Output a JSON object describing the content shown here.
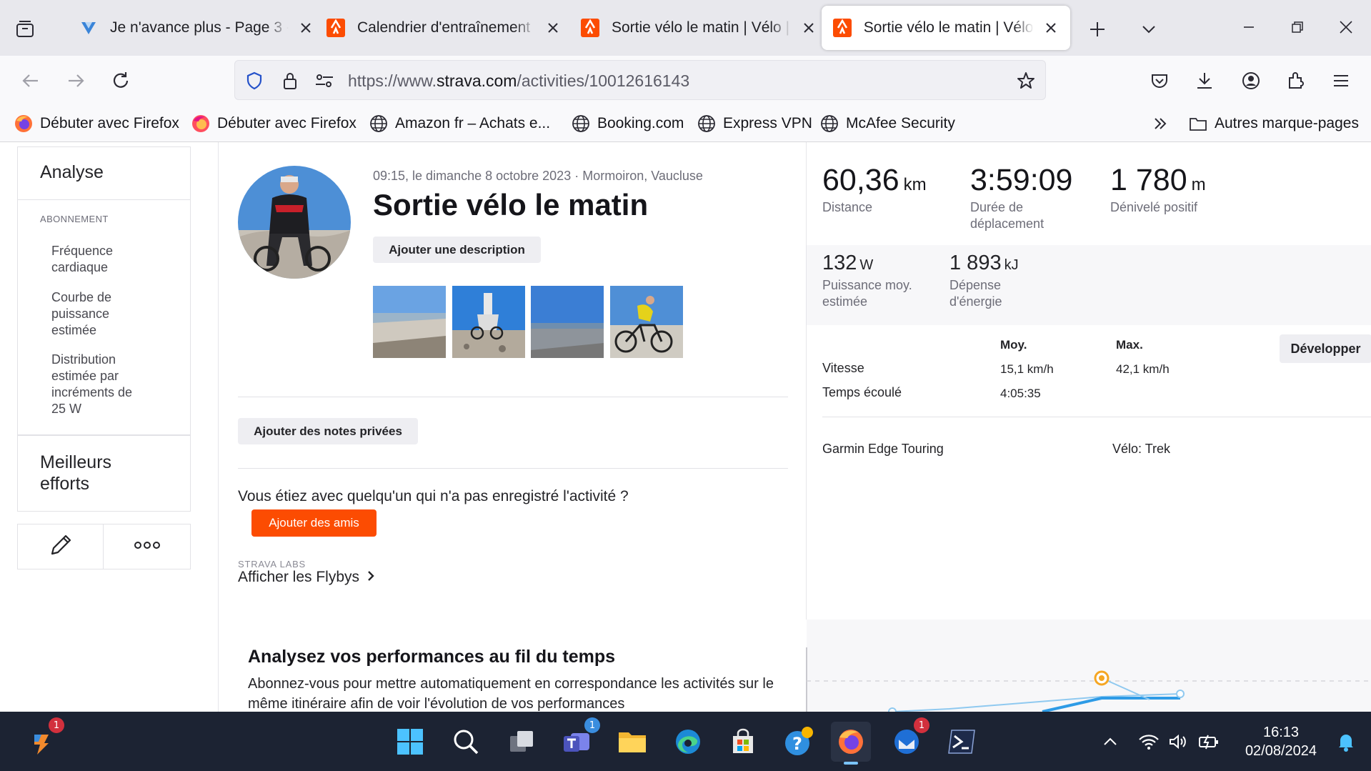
{
  "browser": {
    "tabs": [
      {
        "title": "Je n'avance plus - Page 3 - ",
        "favicon": "mail-v-icon",
        "active": false
      },
      {
        "title": "Calendrier d'entraînement | ",
        "favicon": "strava-icon",
        "active": false
      },
      {
        "title": "Sortie vélo le matin | Vélo | ",
        "favicon": "strava-icon",
        "active": false
      },
      {
        "title": "Sortie vélo le matin | Vélo | ",
        "favicon": "strava-icon",
        "active": true
      }
    ],
    "url": {
      "prefix": "https://www.",
      "host": "strava.com",
      "path": "/activities/10012616143"
    },
    "bookmarks": [
      {
        "label": "Débuter avec Firefox",
        "icon": "firefox-icon"
      },
      {
        "label": "Débuter avec Firefox",
        "icon": "firefox-icon"
      },
      {
        "label": "Amazon fr – Achats e...",
        "icon": "globe-icon"
      },
      {
        "label": "Booking.com",
        "icon": "globe-icon"
      },
      {
        "label": "Express VPN",
        "icon": "globe-icon"
      },
      {
        "label": "McAfee Security",
        "icon": "globe-icon"
      }
    ],
    "other_bookmarks": "Autres marque-pages"
  },
  "sidebar": {
    "analyse": "Analyse",
    "subscription_label": "ABONNEMENT",
    "items": [
      {
        "lines": [
          "Fréquence",
          "cardiaque"
        ]
      },
      {
        "lines": [
          "Courbe de",
          "puissance",
          "estimée"
        ]
      },
      {
        "lines": [
          "Distribution",
          "estimée par",
          "incréments de",
          "25 W"
        ]
      }
    ],
    "best_efforts": [
      "Meilleurs",
      "efforts"
    ]
  },
  "activity": {
    "meta": "09:15, le dimanche 8 octobre 2023 · Mormoiron, Vaucluse",
    "title": "Sortie vélo le matin",
    "add_description": "Ajouter une description",
    "add_private_notes": "Ajouter des notes privées",
    "friend_question": "Vous étiez avec quelqu'un qui n'a pas enregistré l'activité ?",
    "add_friends": "Ajouter des amis",
    "labs_label": "STRAVA LABS",
    "flybys": "Afficher les Flybys"
  },
  "stats": {
    "distance": {
      "value": "60,36",
      "unit": "km",
      "label": "Distance"
    },
    "moving_time": {
      "value": "3:59:09",
      "label_lines": [
        "Durée de",
        "déplacement"
      ]
    },
    "elevation": {
      "value": "1 780",
      "unit": "m",
      "label": "Dénivelé positif"
    },
    "power": {
      "value": "132",
      "unit": "W",
      "label_lines": [
        "Puissance moy.",
        "estimée"
      ]
    },
    "energy": {
      "value": "1 893",
      "unit": "kJ",
      "label_lines": [
        "Dépense",
        "d'énergie"
      ]
    },
    "table": {
      "col_avg": "Moy.",
      "col_max": "Max.",
      "rows": [
        {
          "label": "Vitesse",
          "avg": "15,1 km/h",
          "max": "42,1 km/h"
        },
        {
          "label": "Temps écoulé",
          "avg": "4:05:35",
          "max": ""
        }
      ]
    },
    "develop": "Développer",
    "device": "Garmin Edge Touring",
    "bike": "Vélo: Trek"
  },
  "promo": {
    "title": "Analysez vos performances au fil du temps",
    "body": "Abonnez-vous pour mettre automatiquement en correspondance les activités sur le même itinéraire afin de voir l'évolution de vos performances"
  },
  "taskbar": {
    "time": "16:13",
    "date": "02/08/2024",
    "badges": {
      "left_app": "1",
      "teams": "1",
      "thunderbird": "1"
    }
  },
  "colors": {
    "strava_orange": "#fc4c02",
    "accent_blue": "#0060df"
  }
}
